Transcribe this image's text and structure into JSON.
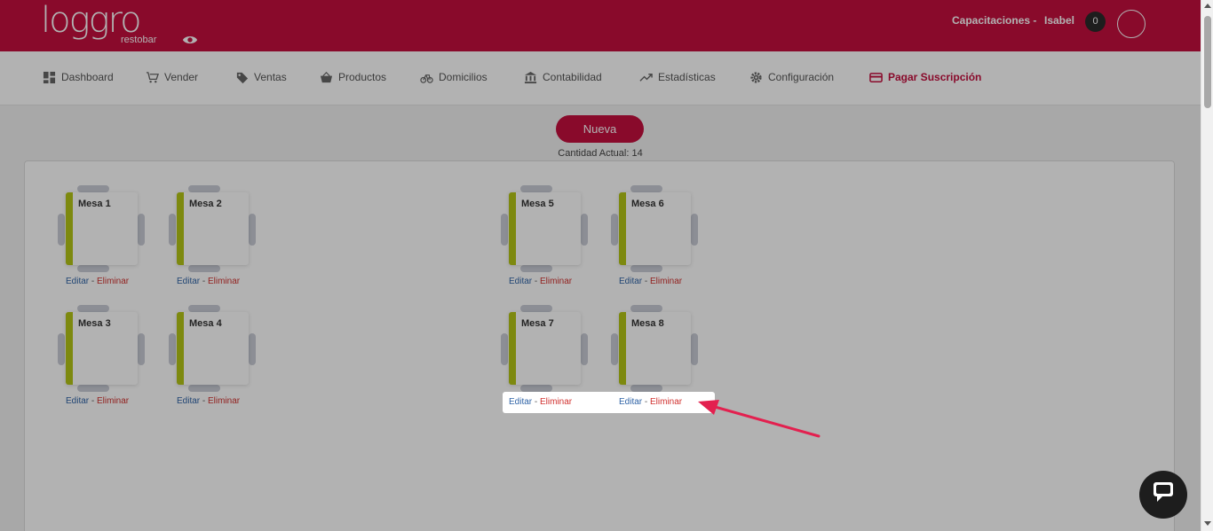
{
  "header": {
    "logo_text": "loggro",
    "logo_sub": "restobar",
    "company": "Capacitaciones -",
    "user": "Isabel",
    "badge_count": "0"
  },
  "nav": {
    "items": [
      {
        "label": "Dashboard",
        "icon": "dashboard-icon"
      },
      {
        "label": "Vender",
        "icon": "cart-icon"
      },
      {
        "label": "Ventas",
        "icon": "tag-icon"
      },
      {
        "label": "Productos",
        "icon": "basket-icon"
      },
      {
        "label": "Domicilios",
        "icon": "bicycle-icon"
      },
      {
        "label": "Contabilidad",
        "icon": "bank-icon"
      },
      {
        "label": "Estadísticas",
        "icon": "trending-icon"
      },
      {
        "label": "Configuración",
        "icon": "gear-icon"
      },
      {
        "label": "Pagar Suscripción",
        "icon": "credit-card-icon"
      }
    ]
  },
  "main": {
    "new_button": "Nueva",
    "count_label": "Cantidad Actual: 14",
    "edit_label": "Editar",
    "separator": " - ",
    "delete_label": "Eliminar"
  },
  "tables": [
    {
      "name": "Mesa 1"
    },
    {
      "name": "Mesa 2"
    },
    {
      "name": "Mesa 5"
    },
    {
      "name": "Mesa 6"
    },
    {
      "name": "Mesa 3"
    },
    {
      "name": "Mesa 4"
    },
    {
      "name": "Mesa 7"
    },
    {
      "name": "Mesa 8"
    }
  ],
  "colors": {
    "brand": "#c40f3e",
    "status_free": "#b3c416",
    "edit_link": "#2f63a6",
    "delete_link": "#d1312f",
    "arrow": "#e3204f"
  }
}
